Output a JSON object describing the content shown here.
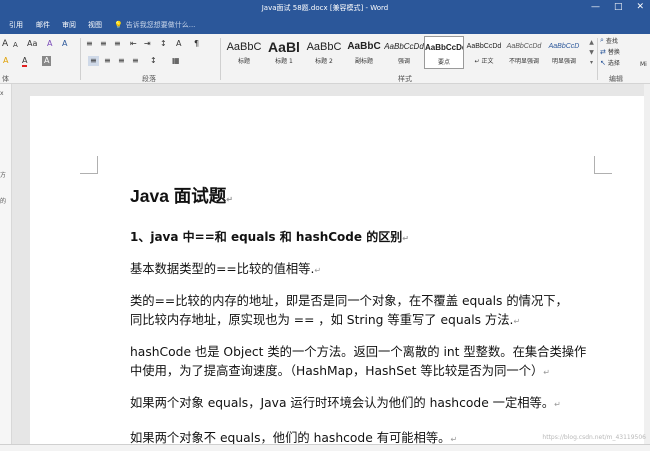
{
  "window": {
    "title": "Java面试 58题.docx [兼容模式] - Word",
    "controls": [
      "—",
      "□",
      "✕"
    ]
  },
  "tabs": [
    "引用",
    "邮件",
    "审阅",
    "视图"
  ],
  "tell_me": {
    "placeholder": "告诉我您想要做什么..."
  },
  "ribbon": {
    "font_row1": [
      "A",
      "A",
      "Aa",
      "A",
      "A"
    ],
    "font_row2": [
      "A",
      "A",
      "A"
    ],
    "para_row1": [
      "≡",
      "≡",
      "≡",
      "⇤",
      "⇥",
      "↕",
      "A",
      "¶"
    ],
    "para_row2": [
      "≡",
      "≡",
      "≡",
      "≡",
      "↕",
      "▦"
    ],
    "group_labels": {
      "font": "体",
      "paragraph": "段落",
      "styles": "样式",
      "editing": "编辑"
    },
    "styles": [
      {
        "preview": "AaBbC",
        "name": "标题"
      },
      {
        "preview": "AaBl",
        "name": "标题 1"
      },
      {
        "preview": "AaBbC",
        "name": "标题 2"
      },
      {
        "preview": "AaBbC",
        "name": "副标题"
      },
      {
        "preview": "AaBbCcDd",
        "name": "强调"
      },
      {
        "preview": "AaBbCcDd",
        "name": "要点"
      },
      {
        "preview": "AaBbCcDd",
        "name": "↵ 正文"
      },
      {
        "preview": "AaBbCcDd",
        "name": "不明显强调"
      },
      {
        "preview": "AaBbCcD",
        "name": "明显强调"
      }
    ],
    "editing": [
      "查找",
      "替换",
      "选择"
    ],
    "right_edge": "Mi"
  },
  "left_pane": [
    "x",
    "方",
    "的"
  ],
  "document": {
    "title": "Java 面试题",
    "heading": "1、java 中==和 equals 和 hashCode 的区别",
    "p1": "基本数据类型的==比较的值相等.",
    "p2a": "类的==比较的内存的地址，即是否是同一个对象，在不覆盖 equals 的情况下，",
    "p2b": "同比较内存地址，原实现也为 == ，如 String 等重写了 equals 方法.",
    "p3a": "hashCode 也是 Object 类的一个方法。返回一个离散的 int 型整数。在集合类操作",
    "p3b": "中使用，为了提高查询速度。（HashMap，HashSet 等比较是否为同一个）",
    "p4": "如果两个对象 equals，Java 运行时环境会认为他们的 hashcode 一定相等。",
    "p5": "如果两个对象不 equals，他们的 hashcode 有可能相等。",
    "para_mark": "↵"
  },
  "watermark": "https://blog.csdn.net/m_43119506"
}
